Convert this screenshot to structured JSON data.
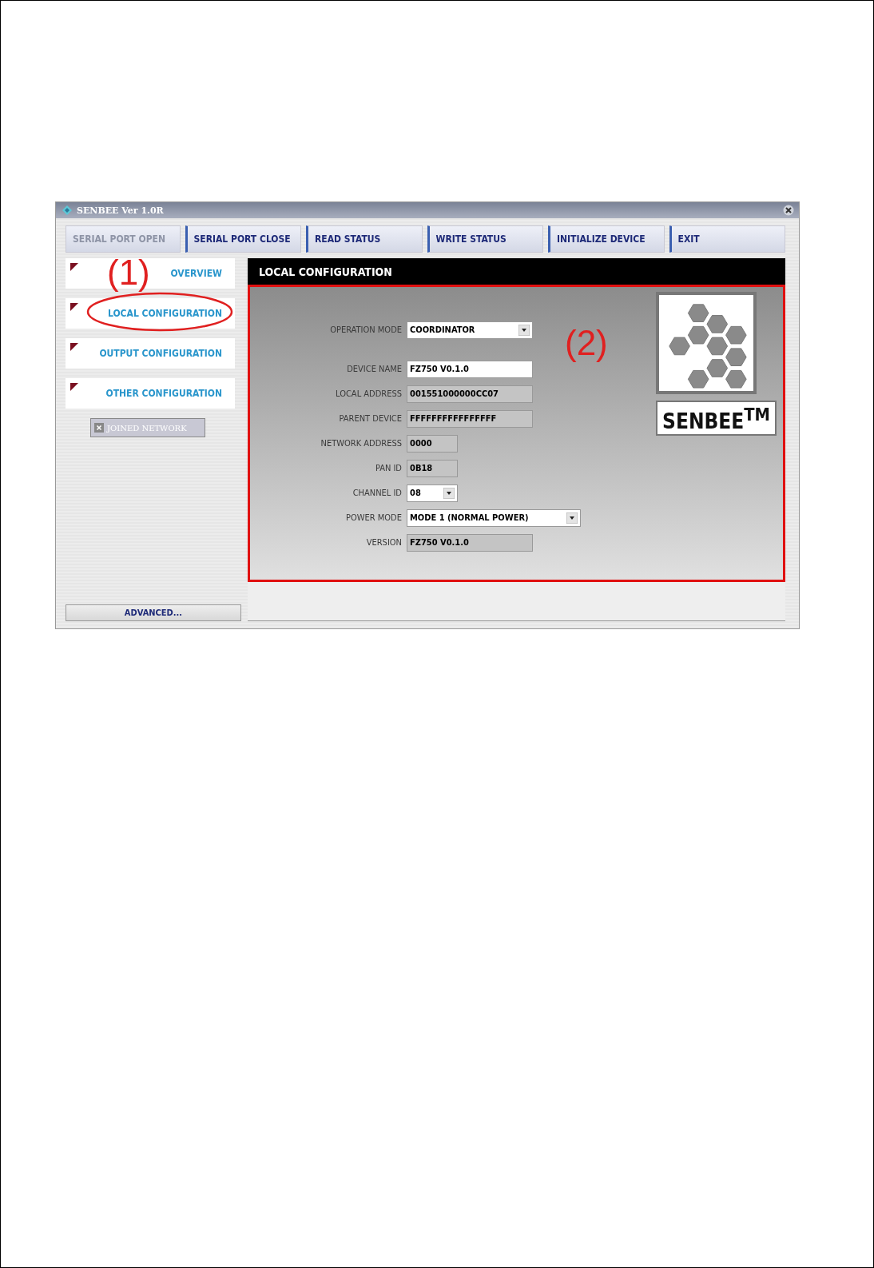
{
  "window": {
    "title": "SENBEE Ver 1.0R"
  },
  "toolbar": [
    {
      "label": "SERIAL PORT OPEN",
      "disabled": true
    },
    {
      "label": "SERIAL PORT CLOSE",
      "disabled": false
    },
    {
      "label": "READ STATUS",
      "disabled": false
    },
    {
      "label": "WRITE STATUS",
      "disabled": false
    },
    {
      "label": "INITIALIZE DEVICE",
      "disabled": false
    },
    {
      "label": "EXIT",
      "disabled": false
    }
  ],
  "sidebar": {
    "items": [
      {
        "label": "OVERVIEW"
      },
      {
        "label": "LOCAL CONFIGURATION"
      },
      {
        "label": "OUTPUT CONFIGURATION"
      },
      {
        "label": "OTHER CONFIGURATION"
      }
    ],
    "joined_network": {
      "label": "JOINED NETWORK",
      "disabled": true
    },
    "advanced_button": "ADVANCED..."
  },
  "panel": {
    "title": "LOCAL CONFIGURATION",
    "fields": [
      {
        "label": "OPERATION MODE",
        "value": "COORDINATOR",
        "kind": "dropdown"
      },
      {
        "label": "DEVICE NAME",
        "value": "FZ750 V0.1.0",
        "kind": "text"
      },
      {
        "label": "LOCAL ADDRESS",
        "value": "001551000000CC07",
        "kind": "readonly"
      },
      {
        "label": "PARENT DEVICE",
        "value": "FFFFFFFFFFFFFFFF",
        "kind": "readonly"
      },
      {
        "label": "NETWORK ADDRESS",
        "value": "0000",
        "kind": "readonly"
      },
      {
        "label": "PAN ID",
        "value": "0B18",
        "kind": "readonly"
      },
      {
        "label": "CHANNEL ID",
        "value": "08",
        "kind": "dropdown"
      },
      {
        "label": "POWER MODE",
        "value": "MODE 1 (NORMAL POWER)",
        "kind": "dropdown"
      },
      {
        "label": "VERSION",
        "value": "FZ750 V0.1.0",
        "kind": "readonly"
      }
    ],
    "logo": "SENBEE$^{TM}$"
  },
  "annotations": [
    {
      "label": "(1)"
    },
    {
      "label": "(2)"
    }
  ]
}
